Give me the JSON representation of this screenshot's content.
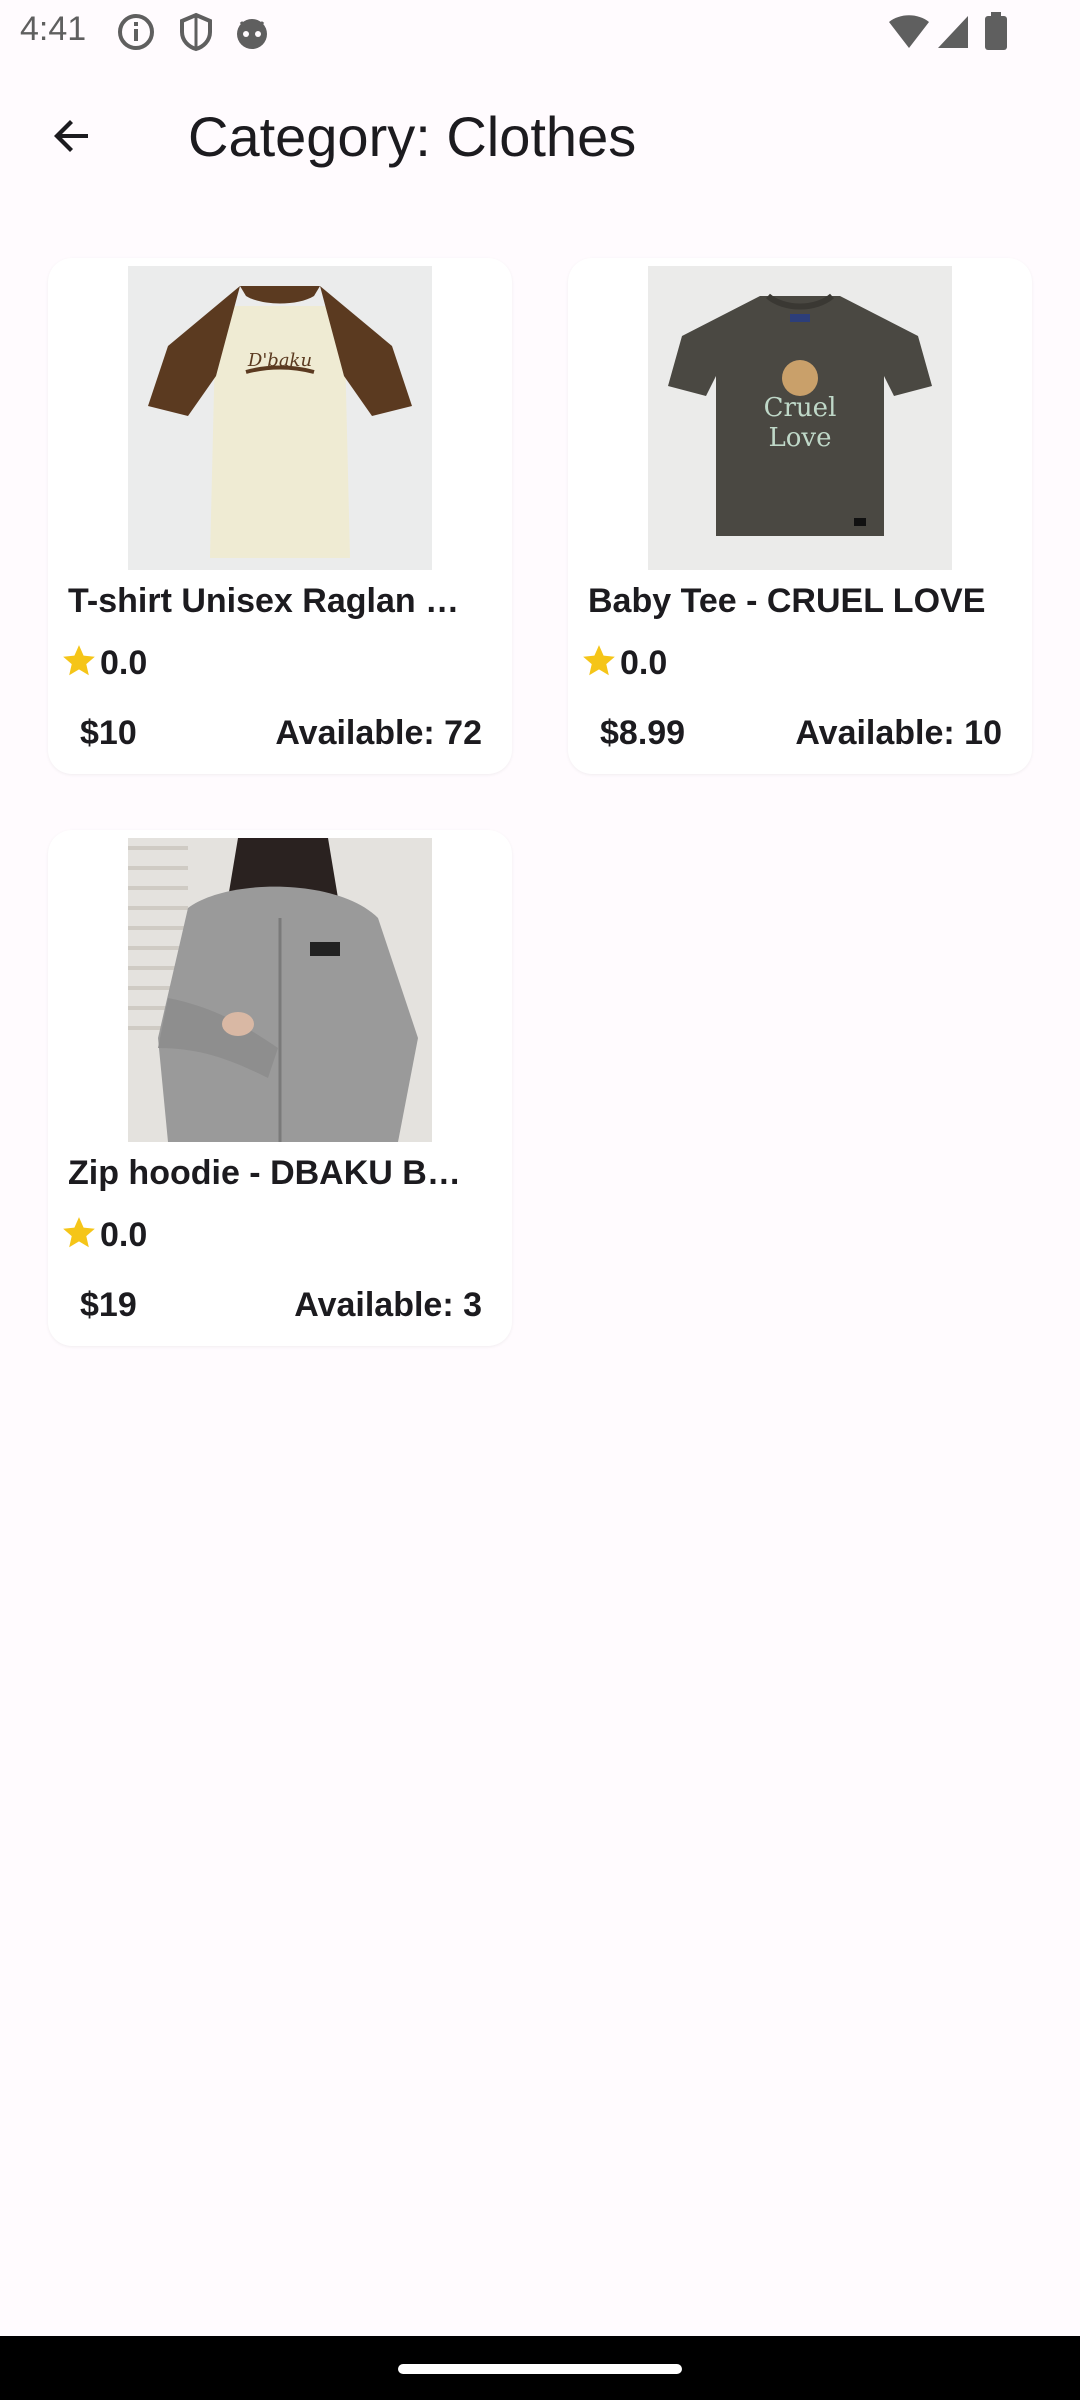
{
  "status_bar": {
    "time": "4:41"
  },
  "app_bar": {
    "title": "Category: Clothes",
    "back_icon": "arrow-back-icon"
  },
  "products": [
    {
      "name": "T-shirt Unisex Raglan …",
      "rating": "0.0",
      "price": "$10",
      "available": "Available: 72",
      "image": "raglan-tshirt-image"
    },
    {
      "name": "Baby Tee - CRUEL LOVE",
      "rating": "0.0",
      "price": "$8.99",
      "available": "Available: 10",
      "image": "cruel-love-tee-image"
    },
    {
      "name": "Zip hoodie - DBAKU B…",
      "rating": "0.0",
      "price": "$19",
      "available": "Available: 3",
      "image": "zip-hoodie-image"
    }
  ],
  "colors": {
    "background": "#fffbfe",
    "card": "#ffffff",
    "text": "#1c1b1f",
    "star": "#f5c518"
  }
}
